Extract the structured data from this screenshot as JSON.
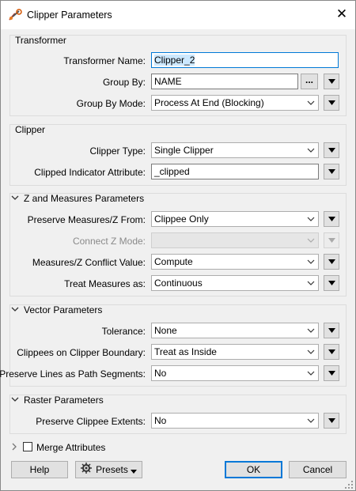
{
  "window": {
    "title": "Clipper Parameters",
    "close_glyph": "✕"
  },
  "transformer": {
    "section_title": "Transformer",
    "name_label": "Transformer Name:",
    "name_value": "Clipper_2",
    "group_by_label": "Group By:",
    "group_by_value": "NAME",
    "ellipsis": "...",
    "group_mode_label": "Group By Mode:",
    "group_mode_value": "Process At End (Blocking)"
  },
  "clipper": {
    "section_title": "Clipper",
    "type_label": "Clipper Type:",
    "type_value": "Single Clipper",
    "indicator_label": "Clipped Indicator Attribute:",
    "indicator_value": "_clipped"
  },
  "zm": {
    "section_title": "Z and Measures Parameters",
    "preserve_label": "Preserve Measures/Z From:",
    "preserve_value": "Clippee Only",
    "connectz_label": "Connect Z Mode:",
    "connectz_value": "",
    "conflict_label": "Measures/Z Conflict Value:",
    "conflict_value": "Compute",
    "treat_label": "Treat Measures as:",
    "treat_value": "Continuous"
  },
  "vector": {
    "section_title": "Vector Parameters",
    "tolerance_label": "Tolerance:",
    "tolerance_value": "None",
    "boundary_label": "Clippees on Clipper Boundary:",
    "boundary_value": "Treat as Inside",
    "lines_label": "Preserve Lines as Path Segments:",
    "lines_value": "No"
  },
  "raster": {
    "section_title": "Raster Parameters",
    "extents_label": "Preserve Clippee Extents:",
    "extents_value": "No"
  },
  "merge": {
    "label": "Merge Attributes",
    "checked": false
  },
  "footer": {
    "help": "Help",
    "presets": "Presets",
    "ok": "OK",
    "cancel": "Cancel"
  },
  "colors": {
    "accent": "#0078d7",
    "selection": "#cce8ff",
    "dialog_bg": "#f0f0f0"
  }
}
